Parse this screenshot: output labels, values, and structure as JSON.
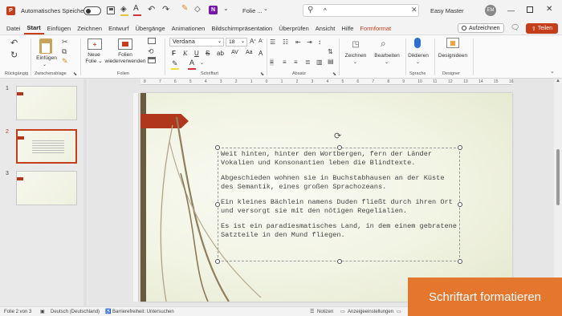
{
  "titlebar": {
    "autosave_label": "Automatisches Speichern",
    "doc_title": "Folie ...",
    "search_text": "^",
    "user_name": "Easy Master",
    "user_initials": "EM"
  },
  "menubar": {
    "items": [
      "Datei",
      "Start",
      "Einfügen",
      "Zeichnen",
      "Entwurf",
      "Übergänge",
      "Animationen",
      "Bildschirmpräsentation",
      "Überprüfen",
      "Ansicht",
      "Hilfe",
      "Formformat"
    ],
    "record_label": "Aufzeichnen",
    "share_label": "Teilen"
  },
  "ribbon": {
    "groups": {
      "undo": "Rückgängig",
      "clipboard": "Zwischenablage",
      "slides": "Folien",
      "font": "Schriftart",
      "paragraph": "Absatz",
      "voice": "Sprache",
      "designer": "Designer"
    },
    "buttons": {
      "paste": "Einfügen",
      "new_slide_1": "Neue",
      "new_slide_2": "Folie ⌄",
      "reuse_1": "Folien",
      "reuse_2": "wiederverwenden",
      "draw": "Zeichnen",
      "editing": "Bearbeiten",
      "dictate": "Diktieren",
      "design_ideas": "Designideen"
    },
    "font_name": "Verdana",
    "font_size": "18"
  },
  "ruler": {
    "numbers": [
      "8",
      "7",
      "6",
      "5",
      "4",
      "3",
      "2",
      "1",
      "0",
      "1",
      "2",
      "3",
      "4",
      "5",
      "6",
      "7",
      "8",
      "9",
      "10",
      "11",
      "12",
      "13",
      "14",
      "15",
      "16"
    ]
  },
  "thumbnails": [
    {
      "num": "1"
    },
    {
      "num": "2"
    },
    {
      "num": "3"
    }
  ],
  "slide": {
    "paragraphs": [
      "Weit hinten, hinter den Wortbergen, fern der Länder Vokalien und Konsonantien leben die Blindtexte.",
      "Abgeschieden wohnen sie in Buchstabhausen an der Küste des Semantik, eines großen Sprachozeans.",
      "Ein kleines Bächlein namens Duden fließt durch ihren Ort und versorgt sie mit den nötigen Regelialien.",
      "Es ist ein paradiesmatisches Land, in dem einem gebratene Satzteile in den Mund fliegen."
    ]
  },
  "statusbar": {
    "slide_info": "Folie 2 von 3",
    "language": "Deutsch (Deutschland)",
    "accessibility": "Barrierefreiheit: Untersuchen",
    "notes": "Notizen",
    "display_settings": "Anzeigeeinstellungen"
  },
  "banner": {
    "text": "Schriftart formatieren"
  },
  "colors": {
    "accent": "#c43e1c",
    "banner": "#e4762d",
    "slide_bar": "#b0361c",
    "slide_stripe": "#6b5b3e"
  }
}
